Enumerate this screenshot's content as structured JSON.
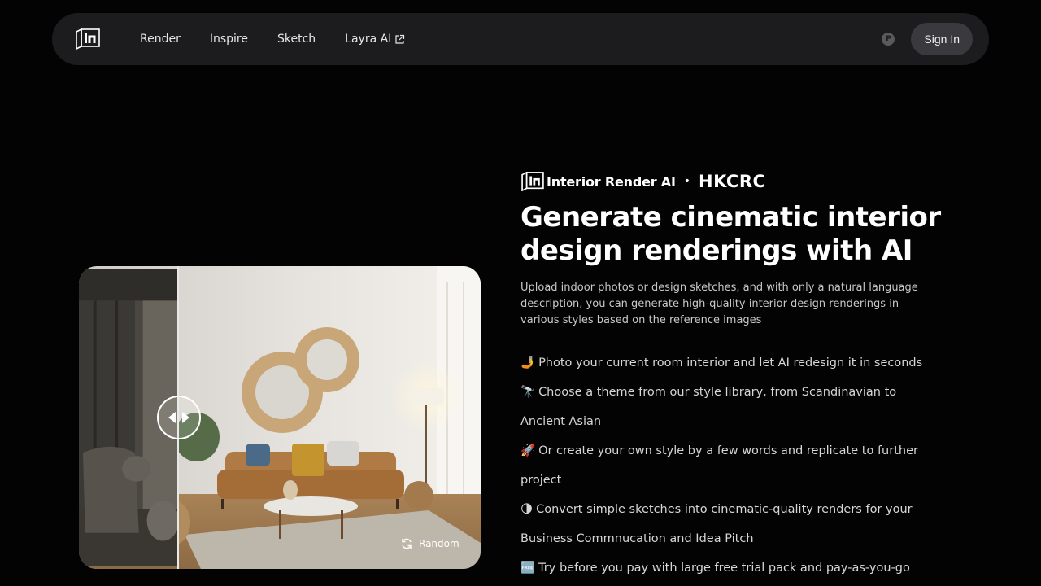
{
  "nav": {
    "logo_icon": "interior-render-logo-icon",
    "links": [
      {
        "label": "Render"
      },
      {
        "label": "Inspire"
      },
      {
        "label": "Sketch"
      },
      {
        "label": "Layra AI",
        "icon": "external-link-icon"
      }
    ],
    "points_icon_glyph": "P",
    "signin_label": "Sign In"
  },
  "hero": {
    "random_label": "Random",
    "random_icon": "refresh-icon"
  },
  "brand": {
    "name": "Interior Render AI",
    "separator": "•",
    "partner": "HKCRC"
  },
  "title": "Generate cinematic interior design renderings with AI",
  "description": "Upload indoor photos or design sketches, and with only a natural language description, you can generate high-quality interior design renderings in various styles based on the reference images",
  "features": [
    {
      "emoji": "🤳",
      "text": "Photo your current room interior and let AI redesign it in seconds"
    },
    {
      "emoji": "🔭",
      "text": "Choose a theme from our style library, from Scandinavian to Ancient Asian"
    },
    {
      "emoji": "🚀",
      "text": "Or create your own style by a few words and replicate to further project"
    },
    {
      "emoji": "🌗",
      "text": "Convert simple sketches into cinematic-quality renders for your Business Commnucation and Idea Pitch"
    },
    {
      "emoji": "🆓",
      "text": "Try before you pay with large free trial pack and pay-as-you-go"
    }
  ],
  "colors": {
    "background": "#030303",
    "navbar": "#1c1c1e",
    "signin_button": "#3a3a3e"
  }
}
